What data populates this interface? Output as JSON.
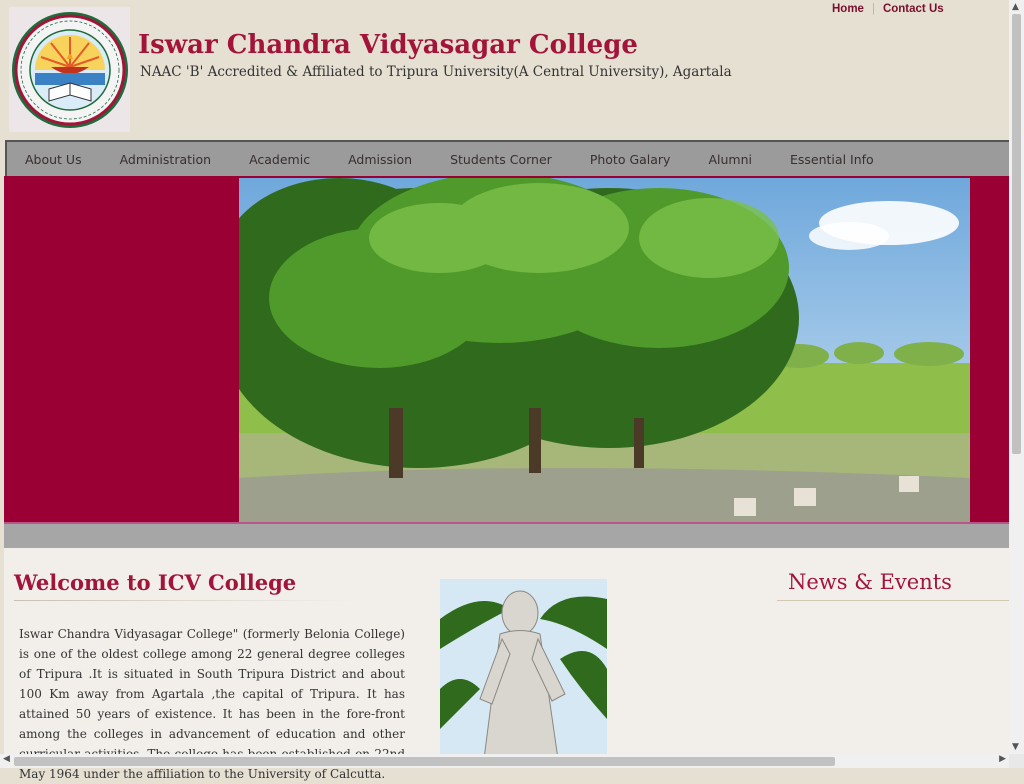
{
  "header": {
    "title": "Iswar Chandra Vidyasagar College",
    "subtitle": "NAAC 'B' Accredited & Affiliated to Tripura University(A Central University), Agartala",
    "logo_icon": "college-emblem-icon",
    "top_links": {
      "home": "Home",
      "separator": "|",
      "contact": "Contact Us"
    }
  },
  "nav": {
    "items": [
      {
        "label": "About Us"
      },
      {
        "label": "Administration"
      },
      {
        "label": "Academic"
      },
      {
        "label": "Admission"
      },
      {
        "label": "Students Corner"
      },
      {
        "label": "Photo Galary"
      },
      {
        "label": "Alumni"
      },
      {
        "label": "Essential Info"
      }
    ]
  },
  "welcome": {
    "heading": "Welcome to ICV College",
    "body": "Iswar Chandra Vidyasagar College\" (formerly Belonia College) is one of the oldest college among 22 general degree colleges of  Tripura .It is situated in South Tripura District and about 100 Km away from Agartala ,the capital of Tripura. It has attained 50 years of existence. It has been in the fore-front among the  colleges in advancement of education and other curricular activities. The college has been established on 22nd May 1964 under the affiliation to the University of Calcutta."
  },
  "news": {
    "heading": "News & Events"
  },
  "colors": {
    "brand": "#a3143b",
    "banner_bg": "#9b0034",
    "nav_bg": "#9b9b9b",
    "page_bg": "#e6e0d3"
  }
}
